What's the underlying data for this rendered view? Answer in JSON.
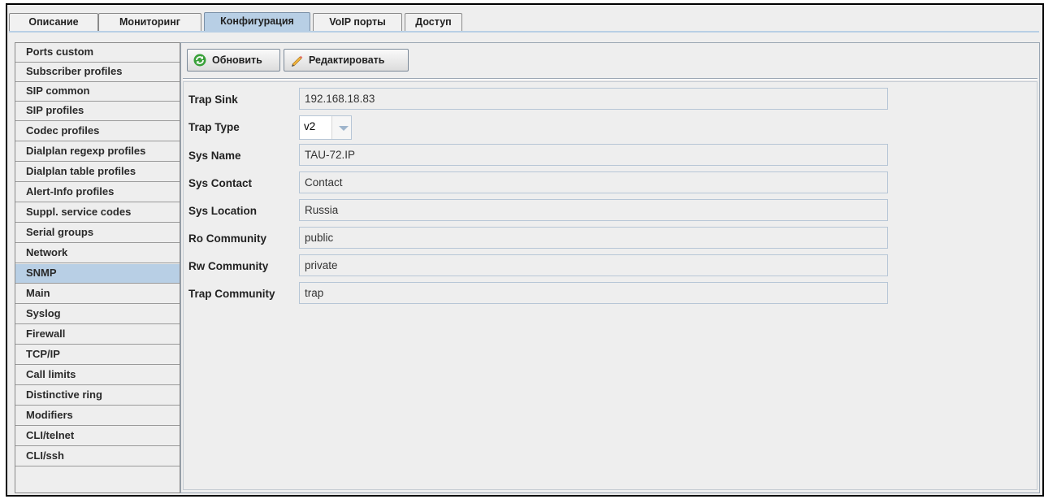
{
  "tabs": [
    "Описание",
    "Мониторинг",
    "Конфигурация",
    "VoIP порты",
    "Доступ"
  ],
  "active_tab": "Конфигурация",
  "sidebar": {
    "items": [
      {
        "label": "Ports custom"
      },
      {
        "label": "Subscriber profiles"
      },
      {
        "label": "SIP common"
      },
      {
        "label": "SIP profiles"
      },
      {
        "label": "Codec profiles"
      },
      {
        "label": "Dialplan regexp profiles"
      },
      {
        "label": "Dialplan table profiles"
      },
      {
        "label": "Alert-Info profiles"
      },
      {
        "label": "Suppl. service codes"
      },
      {
        "label": "Serial groups"
      },
      {
        "label": "Network"
      },
      {
        "label": "SNMP"
      },
      {
        "label": "Main"
      },
      {
        "label": "Syslog"
      },
      {
        "label": "Firewall"
      },
      {
        "label": "TCP/IP"
      },
      {
        "label": "Call limits"
      },
      {
        "label": "Distinctive ring"
      },
      {
        "label": "Modifiers"
      },
      {
        "label": "CLI/telnet"
      },
      {
        "label": "CLI/ssh"
      }
    ],
    "active": "SNMP"
  },
  "toolbar": {
    "refresh_label": "Обновить",
    "edit_label": "Редактировать",
    "refresh_icon": "refresh-icon",
    "edit_icon": "pencil-icon"
  },
  "form": {
    "trap_sink": {
      "label": "Trap Sink",
      "value": "192.168.18.83"
    },
    "trap_type": {
      "label": "Trap Type",
      "value": "v2"
    },
    "sys_name": {
      "label": "Sys Name",
      "value": "TAU-72.IP"
    },
    "sys_contact": {
      "label": "Sys Contact",
      "value": "Contact"
    },
    "sys_location": {
      "label": "Sys Location",
      "value": "Russia"
    },
    "ro_community": {
      "label": "Ro Community",
      "value": "public"
    },
    "rw_community": {
      "label": "Rw Community",
      "value": "private"
    },
    "trap_community": {
      "label": "Trap Community",
      "value": "trap"
    }
  },
  "colors": {
    "selection": "#b8cfe5",
    "background": "#eeeeee",
    "field_border": "#b7c6d6"
  }
}
